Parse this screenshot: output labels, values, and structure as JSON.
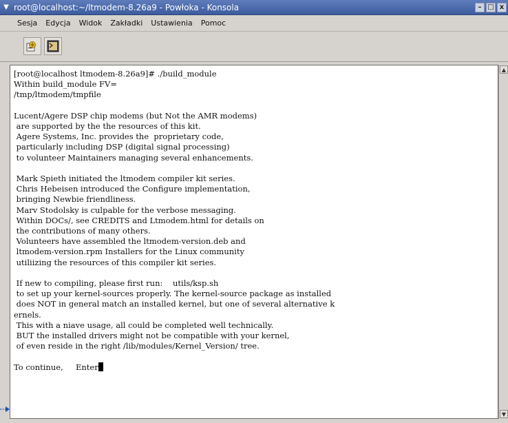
{
  "window": {
    "title": "root@localhost:~/ltmodem-8.26a9 - Powłoka - Konsola",
    "title_color": "#4a68a8",
    "controls": [
      "–",
      "□",
      "x"
    ]
  },
  "menu": {
    "items": [
      "Sesja",
      "Edycja",
      "Widok",
      "Zakładki",
      "Ustawienia",
      "Pomoc"
    ]
  },
  "toolbar": {
    "icons": [
      "new-session-icon",
      "terminal-icon"
    ]
  },
  "terminal": {
    "lines": [
      "[root@localhost ltmodem-8.26a9]# ./build_module",
      "Within build_module FV=",
      "/tmp/ltmodem/tmpfile",
      "",
      "Lucent/Agere DSP chip modems (but Not the AMR modems)",
      " are supported by the the resources of this kit.",
      " Agere Systems, Inc. provides the  proprietary code,",
      " particularly including DSP (digital signal processing)",
      " to volunteer Maintainers managing several enhancements.",
      "",
      " Mark Spieth initiated the ltmodem compiler kit series.",
      " Chris Hebeisen introduced the Configure implementation,",
      " bringing Newbie friendliness.",
      " Marv Stodolsky is culpable for the verbose messaging.",
      " Within DOCs/, see CREDITS and Ltmodem.html for details on",
      " the contributions of many others.",
      " Volunteers have assembled the ltmodem-version.deb and",
      " ltmodem-version.rpm Installers for the Linux community",
      " utiliizing the resources of this compiler kit series.",
      "",
      " If new to compiling, please first run:    utils/ksp.sh",
      " to set up your kernel-sources properly. The kernel-source package as installed",
      " does NOT in general match an installed kernel, but one of several alternative k",
      "ernels.",
      " This with a niave usage, all could be completed well technically.",
      " BUT the installed drivers might not be compatible with your kernel,",
      " of even reside in the right /lib/modules/Kernel_Version/ tree.",
      ""
    ],
    "prompt": "To continue,     Enter"
  },
  "annotation": {
    "marker_color": "#1e4fb0"
  }
}
